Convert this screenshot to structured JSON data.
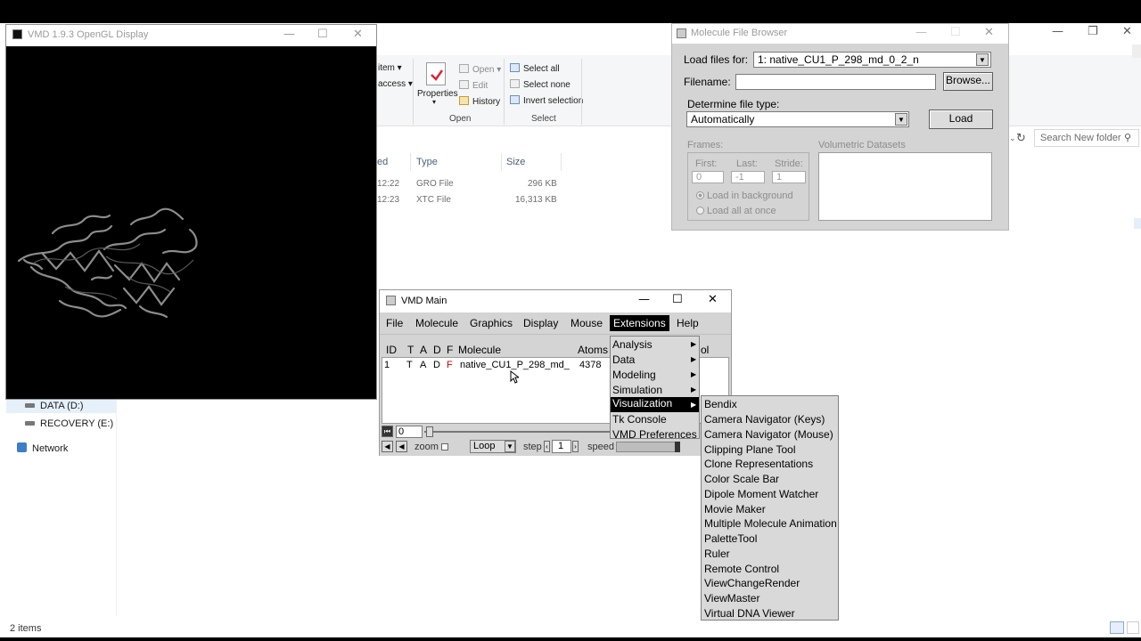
{
  "gl_display": {
    "title": "VMD 1.9.3 OpenGL Display"
  },
  "explorer": {
    "ribbon": {
      "item_label": "item",
      "access_label": "access",
      "properties": "Properties",
      "open": "Open",
      "edit": "Edit",
      "history": "History",
      "open_group": "Open",
      "select_all": "Select all",
      "select_none": "Select none",
      "invert_selection": "Invert selection",
      "select_group": "Select"
    },
    "search_placeholder": "Search New folder",
    "columns": [
      "ed",
      "Type",
      "Size"
    ],
    "files": [
      {
        "date": "12:22",
        "type": "GRO File",
        "size": "296 KB"
      },
      {
        "date": "12:23",
        "type": "XTC File",
        "size": "16,313 KB"
      }
    ],
    "nav": [
      {
        "label": "DATA (D:)"
      },
      {
        "label": "RECOVERY (E:)"
      },
      {
        "label": "Network"
      }
    ],
    "status": "2 items"
  },
  "file_browser": {
    "title": "Molecule File Browser",
    "load_files_for_label": "Load files for:",
    "load_files_for_value": "1: native_CU1_P_298_md_0_2_n",
    "filename_label": "Filename:",
    "filename_value": "",
    "browse_button": "Browse...",
    "file_type_label": "Determine file type:",
    "file_type_value": "Automatically",
    "load_button": "Load",
    "frames_label": "Frames:",
    "first_label": "First:",
    "first_value": "0",
    "last_label": "Last:",
    "last_value": "-1",
    "stride_label": "Stride:",
    "stride_value": "1",
    "load_background": "Load in background",
    "load_all": "Load all at once",
    "volumetric_label": "Volumetric Datasets"
  },
  "vmd_main": {
    "title": "VMD Main",
    "menu": [
      "File",
      "Molecule",
      "Graphics",
      "Display",
      "Mouse",
      "Extensions",
      "Help"
    ],
    "columns": {
      "id": "ID",
      "t": "T",
      "a": "A",
      "d": "D",
      "f": "F",
      "molecule": "Molecule",
      "atoms": "Atoms",
      "vol": "ol"
    },
    "molecule_row": {
      "id": "1",
      "t": "T",
      "a": "A",
      "d": "D",
      "f": "F",
      "molecule": "native_CU1_P_298_md_",
      "atoms": "4378"
    },
    "frame_value": "0",
    "zoom_label": "zoom",
    "loop_value": "Loop",
    "step_label": "step",
    "step_value": "1",
    "speed_label": "speed"
  },
  "extensions_menu": [
    "Analysis",
    "Data",
    "Modeling",
    "Simulation",
    "Visualization",
    "Tk Console",
    "VMD Preferences"
  ],
  "visualization_menu": [
    "Bendix",
    "Camera Navigator (Keys)",
    "Camera Navigator (Mouse)",
    "Clipping Plane Tool",
    "Clone Representations",
    "Color Scale Bar",
    "Dipole Moment Watcher",
    "Movie Maker",
    "Multiple Molecule Animation",
    "PaletteTool",
    "Ruler",
    "Remote Control",
    "ViewChangeRender",
    "ViewMaster",
    "Virtual DNA Viewer"
  ],
  "colors": {
    "flag_red": "#cc0000",
    "menu_highlight": "#000000",
    "tk_gray": "#d4d4d4"
  }
}
